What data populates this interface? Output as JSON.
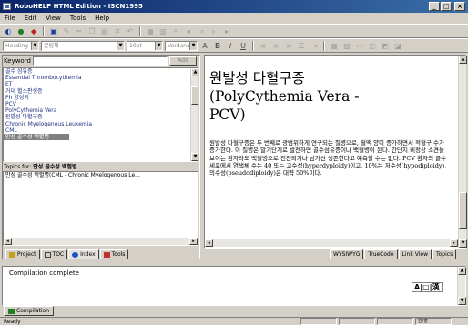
{
  "window": {
    "title": "RoboHELP HTML Edition - ISCN1995"
  },
  "menu": [
    "File",
    "Edit",
    "View",
    "Tools",
    "Help"
  ],
  "toolbar2": {
    "style_value": "Heading 1",
    "font_value": "굴림체",
    "size_value": "10pt",
    "font2_value": "Verdana"
  },
  "keyword": {
    "label": "Keyword",
    "button_label": "Add"
  },
  "keywords": [
    "골수 섬유증",
    "Essential Thrombocythemia",
    "ET",
    "거대 혈소판생증",
    "Ph 양성의",
    "PCV",
    "PolyCythemia Vera",
    "원발성 다혈구증",
    "Chronic Myelogenous Leukemia",
    "CML",
    "만성 골수성 백혈병"
  ],
  "topics": {
    "label_prefix": "Topics for:",
    "label_key": "만성 골수성 백혈병",
    "rows": [
      "만성 골수성 백혈병(CML - Chronic Myelogenous Le..."
    ]
  },
  "left_tabs": [
    {
      "label": "Project",
      "icon": "folder-icon",
      "color": "#c8a020"
    },
    {
      "label": "TOC",
      "icon": "book-icon",
      "color": "#404040"
    },
    {
      "label": "Index",
      "icon": "index-icon",
      "color": "#2050c0"
    },
    {
      "label": "Tools",
      "icon": "tools-icon",
      "color": "#c03030"
    }
  ],
  "editor": {
    "title_line1": "원발성 다혈구증",
    "title_line2": "(PolyCythemia Vera -",
    "title_line3": "PCV)",
    "body": "원발성 다혈구증은 두 번째로 광범위하게 연구되는 질병으로, 혈액 양이 증가하면서 적혈구 수가 증가한다. 이 질병은 말기단계로 발전하면 골수섬유증이나 백혈병이 된다. 간단지 비정상 소견을 보이는 환자라도 백혈병으로 진전되기나 남기신 생존한다고 예측할 수는 없다. PCV 환자의 골수세포에서 염색체 수는 40 또는 고수성(hyperdyploidy)이고, 10%는 저수성(hypodiploidy), 의수성(pseudodiploidy)은 대략 50%이다."
  },
  "right_tabs": [
    "WYSIWYG",
    "TrueCode",
    "Link View",
    "Topics"
  ],
  "output": {
    "text": "Compilation complete",
    "tab_label": "Compilation",
    "ime_label": "A|□|漢"
  },
  "status": {
    "text": "Ready",
    "panel1": "",
    "panel2": "",
    "panel3": "",
    "panel4": "한/영"
  }
}
